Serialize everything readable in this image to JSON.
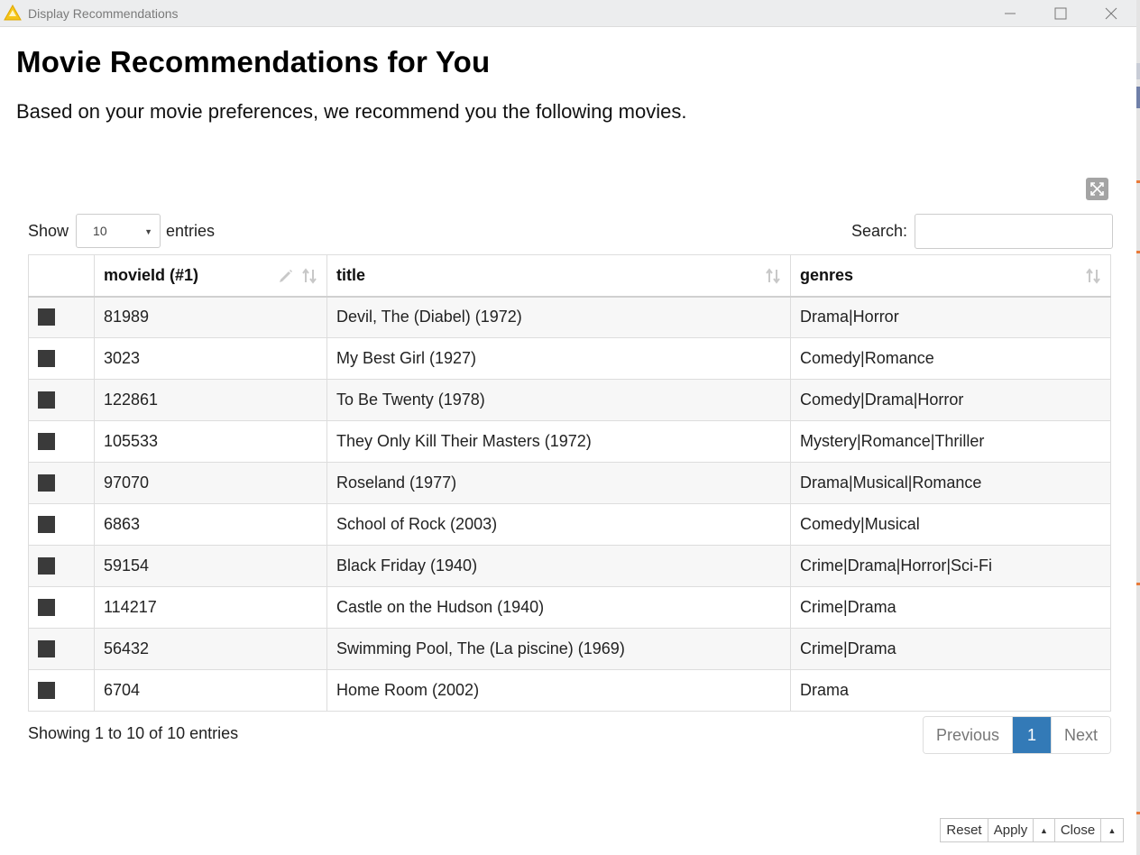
{
  "window": {
    "title": "Display Recommendations",
    "app_icon": "warning-triangle-icon",
    "controls": [
      "minimize-icon",
      "maximize-icon",
      "close-icon"
    ]
  },
  "page": {
    "title": "Movie Recommendations for You",
    "subtitle": "Based on your movie preferences, we recommend you the following movies."
  },
  "table_controls": {
    "show_label": "Show",
    "entries_label": "entries",
    "page_length": "10",
    "search_label": "Search:",
    "search_value": "",
    "search_placeholder": ""
  },
  "table": {
    "columns": [
      {
        "label": ""
      },
      {
        "label": "movieId (#1)"
      },
      {
        "label": "title"
      },
      {
        "label": "genres"
      }
    ],
    "rows": [
      {
        "movieId": "81989",
        "title": "Devil, The (Diabel) (1972)",
        "genres": "Drama|Horror"
      },
      {
        "movieId": "3023",
        "title": "My Best Girl (1927)",
        "genres": "Comedy|Romance"
      },
      {
        "movieId": "122861",
        "title": "To Be Twenty (1978)",
        "genres": "Comedy|Drama|Horror"
      },
      {
        "movieId": "105533",
        "title": "They Only Kill Their Masters (1972)",
        "genres": "Mystery|Romance|Thriller"
      },
      {
        "movieId": "97070",
        "title": "Roseland (1977)",
        "genres": "Drama|Musical|Romance"
      },
      {
        "movieId": "6863",
        "title": "School of Rock (2003)",
        "genres": "Comedy|Musical"
      },
      {
        "movieId": "59154",
        "title": "Black Friday (1940)",
        "genres": "Crime|Drama|Horror|Sci-Fi"
      },
      {
        "movieId": "114217",
        "title": "Castle on the Hudson (1940)",
        "genres": "Crime|Drama"
      },
      {
        "movieId": "56432",
        "title": "Swimming Pool, The (La piscine) (1969)",
        "genres": "Crime|Drama"
      },
      {
        "movieId": "6704",
        "title": "Home Room (2002)",
        "genres": "Drama"
      }
    ]
  },
  "info_text": "Showing 1 to 10 of 10 entries",
  "pagination": {
    "previous": "Previous",
    "current": "1",
    "next": "Next"
  },
  "footer": {
    "reset": "Reset",
    "apply": "Apply",
    "close": "Close"
  },
  "colors": {
    "accent": "#337ab7",
    "checkbox": "#3a3a3a",
    "titlebar": "#ecedee"
  }
}
